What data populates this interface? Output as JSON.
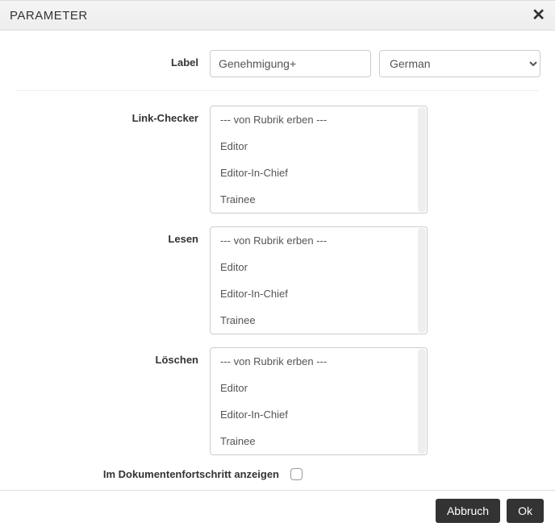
{
  "header": {
    "title": "PARAMETER"
  },
  "form": {
    "label_field": {
      "label": "Label",
      "value": "Genehmigung+"
    },
    "language": {
      "selected": "German"
    },
    "link_checker": {
      "label": "Link-Checker",
      "options": [
        "--- von Rubrik erben ---",
        "Editor",
        "Editor-In-Chief",
        "Trainee"
      ]
    },
    "lesen": {
      "label": "Lesen",
      "options": [
        "--- von Rubrik erben ---",
        "Editor",
        "Editor-In-Chief",
        "Trainee"
      ]
    },
    "loeschen": {
      "label": "Löschen",
      "options": [
        "--- von Rubrik erben ---",
        "Editor",
        "Editor-In-Chief",
        "Trainee"
      ]
    },
    "show_in_progress": {
      "label": "Im Dokumentenfortschritt anzeigen",
      "checked": false
    }
  },
  "footer": {
    "cancel": "Abbruch",
    "ok": "Ok"
  }
}
